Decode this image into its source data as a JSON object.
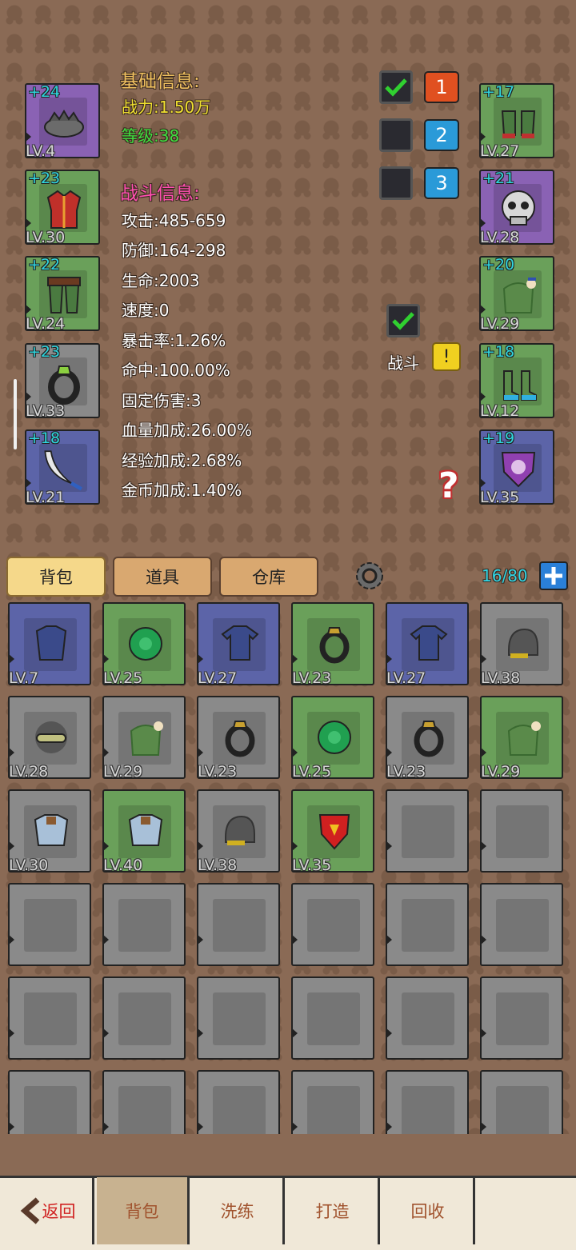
{
  "basic": {
    "title": "基础信息:",
    "power": "战力:1.50万",
    "level": "等级:38"
  },
  "battle": {
    "title": "战斗信息:",
    "stats": [
      "攻击:485-659",
      "防御:164-298",
      "生命:2003",
      "速度:0",
      "暴击率:1.26%",
      "命中:100.00%",
      "固定伤害:3",
      "血量加成:26.00%",
      "经验加成:2.68%",
      "金币加成:1.40%"
    ]
  },
  "left_equip": [
    {
      "plus": "+24",
      "lv": "LV.4",
      "rarity": "purple",
      "icon": "helmet-icon"
    },
    {
      "plus": "+23",
      "lv": "LV.30",
      "rarity": "green",
      "icon": "armor-icon"
    },
    {
      "plus": "+22",
      "lv": "LV.24",
      "rarity": "green",
      "icon": "pants-icon"
    },
    {
      "plus": "+23",
      "lv": "LV.33",
      "rarity": "gray",
      "icon": "ring-icon"
    },
    {
      "plus": "+18",
      "lv": "LV.21",
      "rarity": "blue",
      "icon": "scimitar-icon"
    }
  ],
  "right_equip": [
    {
      "plus": "+17",
      "lv": "LV.27",
      "rarity": "green",
      "icon": "gloves-icon"
    },
    {
      "plus": "+21",
      "lv": "LV.28",
      "rarity": "purple",
      "icon": "skull-mask-icon"
    },
    {
      "plus": "+20",
      "lv": "LV.29",
      "rarity": "green",
      "icon": "cloak-icon"
    },
    {
      "plus": "+18",
      "lv": "LV.12",
      "rarity": "green",
      "icon": "boots-icon"
    },
    {
      "plus": "+19",
      "lv": "LV.35",
      "rarity": "blue",
      "icon": "shield-icon"
    }
  ],
  "presets": [
    "1",
    "2",
    "3"
  ],
  "battle_toggle_label": "战斗",
  "warning_symbol": "!",
  "help_symbol": "?",
  "tabs": [
    "背包",
    "道具",
    "仓库"
  ],
  "capacity": "16/80",
  "bag_items": [
    {
      "lv": "LV.7",
      "rarity": "blue",
      "icon": "tunic-icon"
    },
    {
      "lv": "LV.25",
      "rarity": "green",
      "icon": "turtle-shell-icon"
    },
    {
      "lv": "LV.27",
      "rarity": "blue",
      "icon": "shirt-icon"
    },
    {
      "lv": "LV.23",
      "rarity": "green",
      "icon": "ring-icon"
    },
    {
      "lv": "LV.27",
      "rarity": "blue",
      "icon": "shirt-icon"
    },
    {
      "lv": "LV.38",
      "rarity": "gray",
      "icon": "helmet-icon"
    },
    {
      "lv": "LV.28",
      "rarity": "gray",
      "icon": "goggles-icon"
    },
    {
      "lv": "LV.29",
      "rarity": "gray",
      "icon": "cloak-icon"
    },
    {
      "lv": "LV.23",
      "rarity": "gray",
      "icon": "ring-icon"
    },
    {
      "lv": "LV.25",
      "rarity": "green",
      "icon": "turtle-shell-icon"
    },
    {
      "lv": "LV.23",
      "rarity": "gray",
      "icon": "ring-icon"
    },
    {
      "lv": "LV.29",
      "rarity": "green",
      "icon": "cloak-icon"
    },
    {
      "lv": "LV.30",
      "rarity": "gray",
      "icon": "plate-armor-icon"
    },
    {
      "lv": "LV.40",
      "rarity": "green",
      "icon": "plate-armor-icon"
    },
    {
      "lv": "LV.38",
      "rarity": "gray",
      "icon": "helmet-icon"
    },
    {
      "lv": "LV.35",
      "rarity": "green",
      "icon": "shield-icon"
    }
  ],
  "bottom_nav": [
    "返回",
    "背包",
    "洗练",
    "打造",
    "回收",
    ""
  ]
}
